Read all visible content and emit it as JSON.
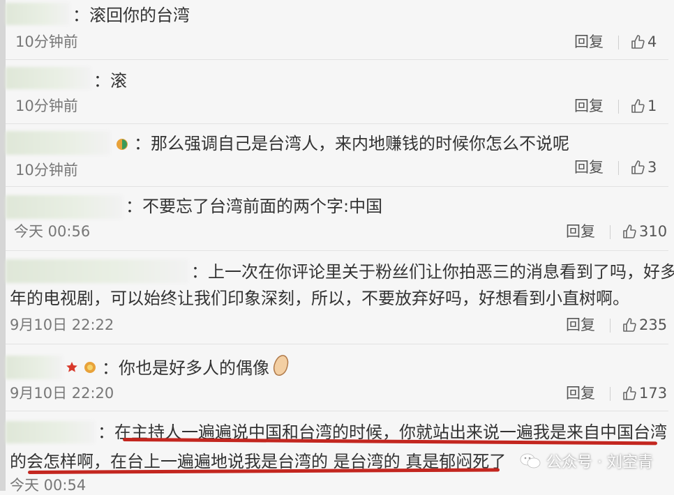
{
  "comments": [
    {
      "text": "：滚回你的台湾",
      "time": "10分钟前",
      "reply": "回复",
      "likes": "4"
    },
    {
      "text": "：滚",
      "time": "10分钟前",
      "reply": "回复",
      "likes": "1"
    },
    {
      "text": "：那么强调自己是台湾人，来内地赚钱的时候你怎么不说呢",
      "time": "10分钟前",
      "reply": "回复",
      "likes": "3"
    },
    {
      "text": "：不要忘了台湾前面的两个字:中国",
      "time": "今天 00:56",
      "reply": "回复",
      "likes": "310"
    },
    {
      "text": "：上一次在你评论里关于粉丝们让你拍恶三的消息看到了吗，好多",
      "text2": "年的电视剧，可以始终让我们印象深刻，所以，不要放弃好吗，好想看到小直树啊。",
      "time": "9月10日 22:22",
      "reply": "回复",
      "likes": "235"
    },
    {
      "text": "：你也是好多人的偶像",
      "time": "9月10日 22:20",
      "reply": "回复",
      "likes": "173"
    },
    {
      "text": "：在主持人一遍遍说中国和台湾的时候，你就站出来说一遍我是来自中国台湾",
      "text2": "的会怎样啊，在台上一遍遍地说我是台湾的 是台湾的 真是郁闷死了",
      "time": "今天 00:54"
    }
  ],
  "watermark": {
    "text": "公众号 · 刘空青",
    "icon": "wechat-icon"
  },
  "colors": {
    "underline": "#c3261f",
    "badge_gold": "#e8a23a",
    "badge_star": "#d8392b"
  }
}
